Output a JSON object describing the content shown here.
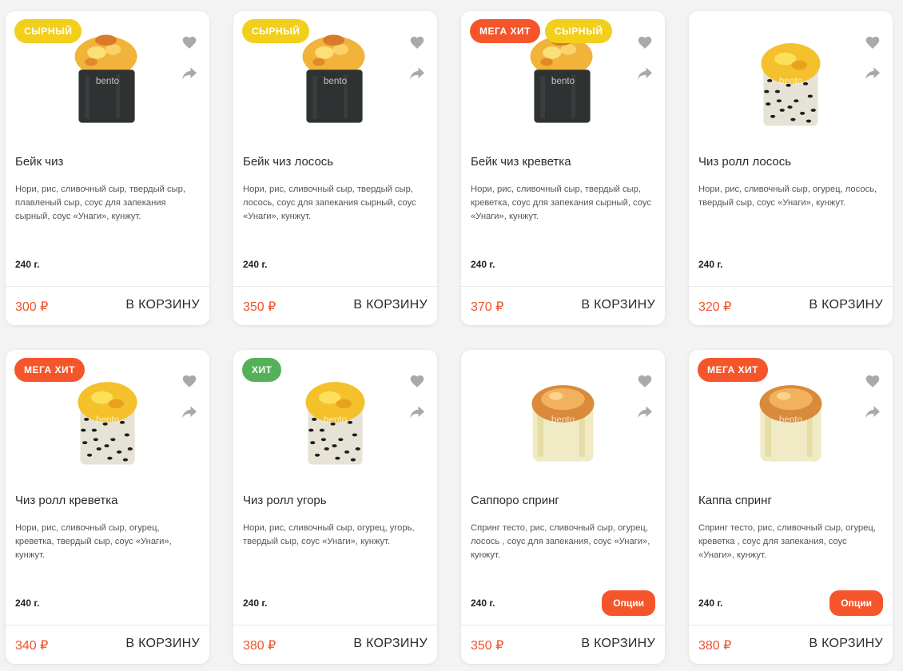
{
  "colors": {
    "badge_cheese": "#f2cf1b",
    "badge_mega_hit": "#f5552a",
    "badge_hit": "#55b05a",
    "price": "#f0522b",
    "options_button": "#f5552a"
  },
  "icons": {
    "favorite": "heart-icon",
    "share": "share-icon"
  },
  "cards": [
    {
      "badges": [
        {
          "text": "СЫРНЫЙ",
          "kind": "cheese"
        }
      ],
      "image": "baked-nori-roll",
      "watermark": "bento",
      "title": "Бейк чиз",
      "description": "Нори, рис, сливочный сыр, твердый сыр, плавленый сыр, соус для запекания сырный, соус «Унаги», кунжут.",
      "weight": "240 г.",
      "price": "300 ₽",
      "cart_label": "В КОРЗИНУ"
    },
    {
      "badges": [
        {
          "text": "СЫРНЫЙ",
          "kind": "cheese"
        }
      ],
      "image": "baked-nori-roll",
      "watermark": "bento",
      "title": "Бейк чиз лосось",
      "description": "Нори, рис, сливочный сыр, твердый сыр, лосось, соус для запекания сырный, соус «Унаги», кунжут.",
      "weight": "240 г.",
      "price": "350 ₽",
      "cart_label": "В КОРЗИНУ"
    },
    {
      "badges": [
        {
          "text": "МЕГА ХИТ",
          "kind": "mega"
        },
        {
          "text": "СЫРНЫЙ",
          "kind": "cheese"
        }
      ],
      "image": "baked-nori-roll",
      "watermark": "bento",
      "title": "Бейк чиз креветка",
      "description": "Нори, рис, сливочный сыр, твердый сыр, креветка, соус для запекания сырный, соус «Унаги», кунжут.",
      "weight": "240 г.",
      "price": "370 ₽",
      "cart_label": "В КОРЗИНУ"
    },
    {
      "badges": [],
      "image": "sesame-cheese-roll",
      "watermark": "bento",
      "title": "Чиз ролл лосось",
      "description": "Нори, рис, сливочный сыр, огурец, лосось, твердый сыр, соус «Унаги», кунжут.",
      "weight": "240 г.",
      "price": "320 ₽",
      "cart_label": "В КОРЗИНУ"
    },
    {
      "badges": [
        {
          "text": "МЕГА ХИТ",
          "kind": "mega"
        }
      ],
      "image": "sesame-cheese-roll",
      "watermark": "bento",
      "title": "Чиз ролл креветка",
      "description": "Нори, рис, сливочный сыр, огурец, креветка, твердый сыр, соус «Унаги», кунжут.",
      "weight": "240 г.",
      "price": "340 ₽",
      "cart_label": "В КОРЗИНУ"
    },
    {
      "badges": [
        {
          "text": "ХИТ",
          "kind": "hit"
        }
      ],
      "image": "sesame-cheese-roll",
      "watermark": "bento",
      "title": "Чиз ролл угорь",
      "description": "Нори, рис, сливочный сыр, огурец, угорь, твердый сыр, соус «Унаги», кунжут.",
      "weight": "240 г.",
      "price": "380 ₽",
      "cart_label": "В КОРЗИНУ"
    },
    {
      "badges": [],
      "image": "spring-dough-roll",
      "watermark": "bento",
      "title": "Саппоро спринг",
      "description": "Спринг тесто, рис, сливочный сыр, огурец, лосось , соус для запекания, соус «Унаги», кунжут.",
      "weight": "240 г.",
      "options_label": "Опции",
      "price": "350 ₽",
      "cart_label": "В КОРЗИНУ"
    },
    {
      "badges": [
        {
          "text": "МЕГА ХИТ",
          "kind": "mega"
        }
      ],
      "image": "spring-dough-roll",
      "watermark": "bento",
      "title": "Каппа спринг",
      "description": "Спринг тесто, рис, сливочный сыр, огурец, креветка , соус для запекания, соус «Унаги», кунжут.",
      "weight": "240 г.",
      "options_label": "Опции",
      "price": "380 ₽",
      "cart_label": "В КОРЗИНУ"
    }
  ]
}
